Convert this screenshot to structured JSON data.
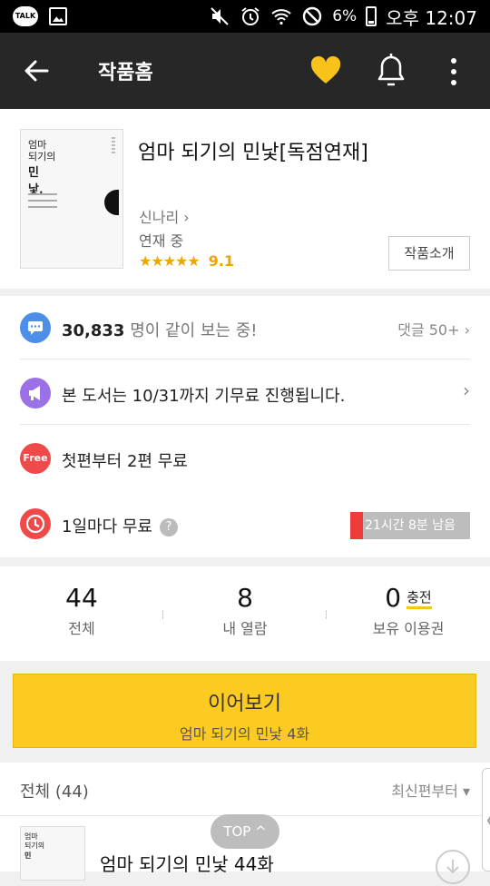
{
  "status_bar": {
    "talk_label": "TALK",
    "battery_pct": "6%",
    "time": "오후 12:07"
  },
  "app_bar": {
    "title": "작품홈"
  },
  "book": {
    "cover_title_line1": "엄마",
    "cover_title_line2": "되기의",
    "cover_title_line3": "민",
    "cover_title_line4": "낯.",
    "title": "엄마 되기의 민낯[독점연재]",
    "author": "신나리 ›",
    "status": "연재 중",
    "stars": "★★★★★",
    "rating": "9.1",
    "intro_button": "작품소개"
  },
  "info": {
    "viewers_count": "30,833",
    "viewers_suffix": " 명이 같이 보는 중!",
    "comments": "댓글 50+ ›",
    "notice": "본 도서는 10/31까지 기무료 진행됩니다.",
    "notice_arrow": "›",
    "free_badge": "Free",
    "free_text": "첫편부터 2편 무료",
    "daily_text": "1일마다 무료",
    "help": "?",
    "timer": "21시간 8분 남음"
  },
  "counts": {
    "total_num": "44",
    "total_label": "전체",
    "read_num": "8",
    "read_label": "내 열람",
    "owned_num": "0",
    "charge_label": "충전",
    "owned_label": "보유 이용권"
  },
  "continue": {
    "label": "이어보기",
    "episode": "엄마 되기의 민낯 4화"
  },
  "list": {
    "all_label": "전체 (44)",
    "sort_label": "최신편부터 ▾",
    "first_episode_title": "엄마 되기의 민낯 44화",
    "top_button": "TOP ^"
  }
}
